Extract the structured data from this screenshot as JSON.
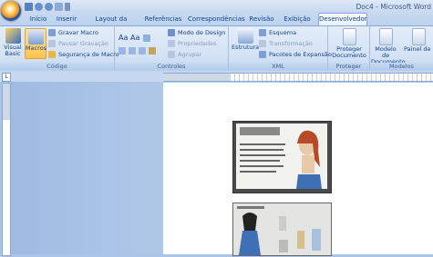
{
  "window": {
    "title": "Doc4 - Microsoft Word"
  },
  "tabs": [
    "Início",
    "Inserir",
    "Layout da Página",
    "Referências",
    "Correspondências",
    "Revisão",
    "Exibição",
    "Desenvolvedor"
  ],
  "active_tab": "Desenvolvedor",
  "ribbon": {
    "codigo": {
      "label": "Código",
      "visual_basic": "Visual Basic",
      "macros": "Macros",
      "gravar_macro": "Gravar Macro",
      "pausar_gravacao": "Pausar Gravação",
      "seguranca_macro": "Segurança de Macro"
    },
    "controles": {
      "label": "Controles",
      "aa1": "Aa",
      "aa2": "Aa",
      "modo_design": "Modo de Design",
      "propriedades": "Propriedades",
      "agrupar": "Agrupar"
    },
    "xml": {
      "label": "XML",
      "estrutura": "Estrutura",
      "esquema": "Esquema",
      "transformacao": "Transformação",
      "pacotes": "Pacotes de Expansão"
    },
    "proteger": {
      "label": "Proteger",
      "proteger_documento": "Proteger Documento"
    },
    "modelos": {
      "label": "Modelos",
      "modelo_documento": "Modelo de Documento",
      "painel_documento": "Painel de Documento"
    }
  },
  "ruler": {
    "corner": "L"
  },
  "icons": [
    "office-button",
    "save-icon",
    "undo-icon",
    "redo-icon",
    "visual-basic-icon",
    "macros-icon",
    "record-macro-icon",
    "pause-icon",
    "macro-security-icon",
    "text-control-icon",
    "design-mode-icon",
    "properties-icon",
    "group-icon",
    "structure-icon",
    "schema-icon",
    "transform-icon",
    "expansion-packs-icon",
    "protect-document-icon",
    "document-template-icon",
    "document-panel-icon"
  ],
  "colors": {
    "ribbon_bg": "#dbe7f6",
    "accent": "#ffc24f",
    "text": "#15428b"
  }
}
